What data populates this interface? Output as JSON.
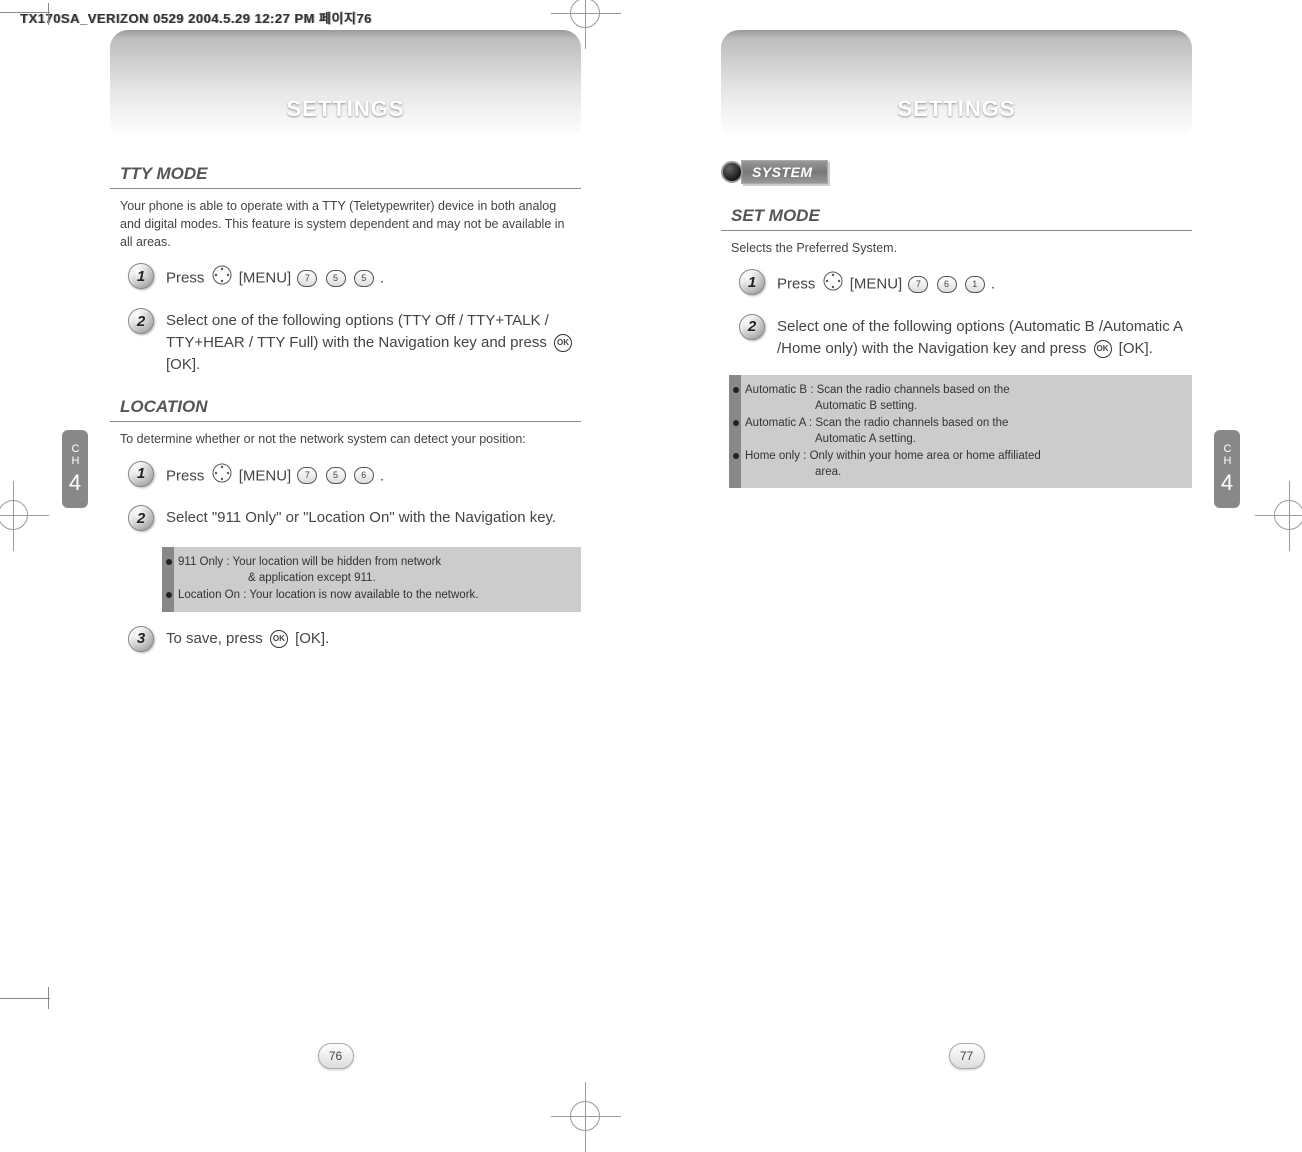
{
  "header_line": "TX170SA_VERIZON 0529  2004.5.29 12:27 PM  페이지76",
  "left_page": {
    "banner": "SETTINGS",
    "ch_label": "CH",
    "ch_num": "4",
    "page_num": "76",
    "tty": {
      "title": "TTY MODE",
      "intro": "Your phone is able to operate with a TTY (Teletypewriter) device in both analog and digital modes. This feature is system dependent and may not be available in all areas.",
      "step1_a": "Press",
      "step1_b": "[MENU]",
      "step1_c": ".",
      "key_seq_1": [
        "7",
        "5",
        "5"
      ],
      "step2": "Select one of the following options (TTY Off / TTY+TALK / TTY+HEAR / TTY Full) with the Navigation key and press",
      "step2_ok": "[OK]."
    },
    "location": {
      "title": "LOCATION",
      "intro": "To determine whether or not the network system can detect your position:",
      "step1_a": "Press",
      "step1_b": "[MENU]",
      "step1_c": ".",
      "key_seq_1": [
        "7",
        "5",
        "6"
      ],
      "step2": "Select \"911 Only\" or \"Location On\" with the Navigation key.",
      "note1_label": "911 Only : ",
      "note1_text": "Your location will be hidden from network",
      "note1_sub": "& application except 911.",
      "note2_label": "Location On : ",
      "note2_text": "Your location is now available to the network.",
      "step3_a": "To save, press",
      "step3_b": "[OK]."
    }
  },
  "right_page": {
    "banner": "SETTINGS",
    "ch_label": "CH",
    "ch_num": "4",
    "page_num": "77",
    "system_label": "SYSTEM",
    "setmode": {
      "title": "SET MODE",
      "intro": "Selects the Preferred System.",
      "step1_a": "Press",
      "step1_b": "[MENU]",
      "step1_c": ".",
      "key_seq_1": [
        "7",
        "6",
        "1"
      ],
      "step2": "Select one of the following options (Automatic B /Automatic A /Home only) with the Navigation key and press",
      "step2_ok": "[OK].",
      "note1_label": "Automatic B : ",
      "note1_text": "Scan the radio channels based on the",
      "note1_sub": "Automatic B setting.",
      "note2_label": "Automatic A : ",
      "note2_text": "Scan the radio channels based on the",
      "note2_sub": "Automatic A setting.",
      "note3_label": "Home only : ",
      "note3_text": "Only within your home area or home affiliated",
      "note3_sub": "area."
    }
  }
}
